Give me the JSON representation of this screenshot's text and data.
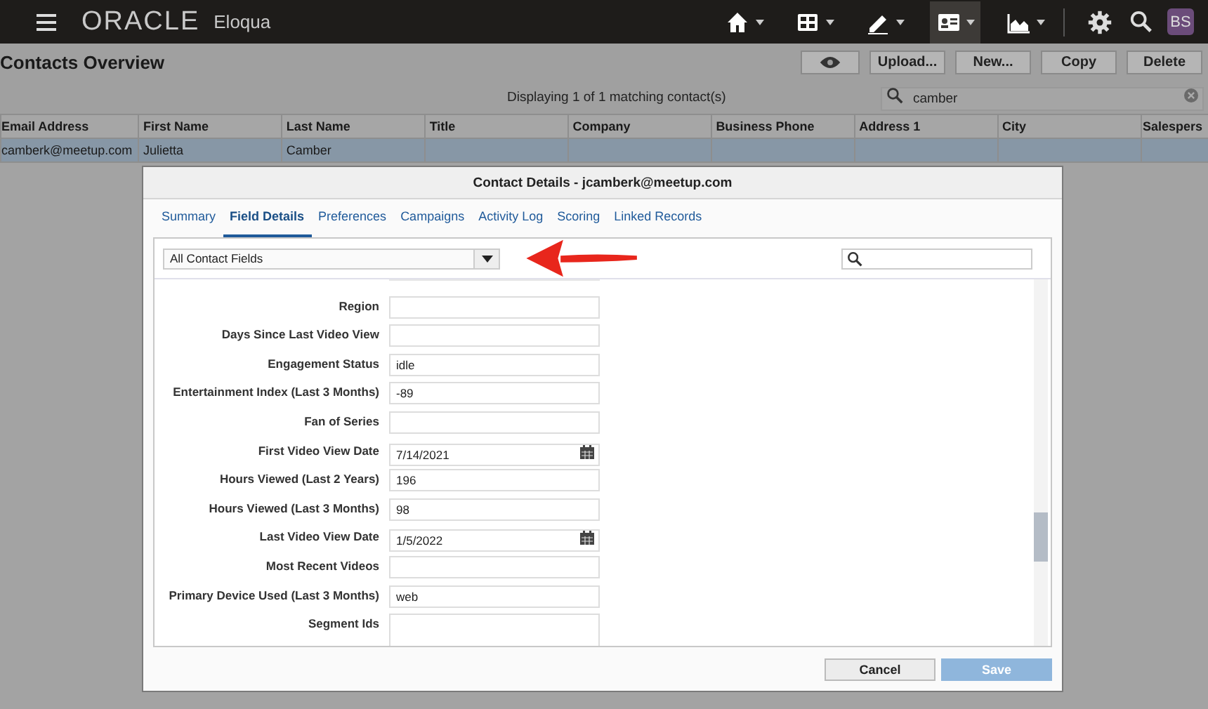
{
  "topbar": {
    "logo": "ORACLE",
    "product": "Eloqua",
    "nav": [
      {
        "kind": "home",
        "selected": false
      },
      {
        "kind": "dashboard",
        "selected": false
      },
      {
        "kind": "edit",
        "selected": false
      },
      {
        "kind": "contacts",
        "selected": true
      },
      {
        "kind": "chart",
        "selected": false
      }
    ],
    "avatar": "BS"
  },
  "page": {
    "title": "Contacts Overview",
    "buttons": [
      "Upload...",
      "New...",
      "Copy",
      "Delete"
    ],
    "status": "Displaying 1 of 1 matching contact(s)",
    "search": {
      "value": "camber"
    }
  },
  "table": {
    "columns": [
      "Email Address",
      "First Name",
      "Last Name",
      "Title",
      "Company",
      "Business Phone",
      "Address 1",
      "City",
      "Salespers"
    ],
    "rows": [
      {
        "cells": [
          "camberk@meetup.com",
          "Julietta",
          "Camber",
          "",
          "",
          "",
          "",
          "",
          ""
        ],
        "selected": true
      }
    ]
  },
  "dialog": {
    "title": "Contact Details - jcamberk@meetup.com",
    "tabs": [
      {
        "label": "Summary",
        "selected": false
      },
      {
        "label": "Field Details",
        "selected": true
      },
      {
        "label": "Preferences",
        "selected": false
      },
      {
        "label": "Campaigns",
        "selected": false
      },
      {
        "label": "Activity Log",
        "selected": false
      },
      {
        "label": "Scoring",
        "selected": false
      },
      {
        "label": "Linked Records",
        "selected": false
      }
    ],
    "filter": "All Contact Fields",
    "fields": [
      {
        "label": "Region",
        "kind": "text"
      },
      {
        "label": "Days Since Last Video View",
        "kind": "text"
      },
      {
        "label": "Engagement Status",
        "value": "idle",
        "kind": "text"
      },
      {
        "label": "Entertainment Index (Last 3 Months)",
        "value": "-89",
        "kind": "text"
      },
      {
        "label": "Fan of Series",
        "kind": "text"
      },
      {
        "label": "First Video View Date",
        "value": "7/14/2021",
        "kind": "date"
      },
      {
        "label": "Hours Viewed (Last 2 Years)",
        "value": "196",
        "kind": "text"
      },
      {
        "label": "Hours Viewed (Last 3 Months)",
        "value": "98",
        "kind": "text"
      },
      {
        "label": "Last Video View Date",
        "value": "1/5/2022",
        "kind": "date"
      },
      {
        "label": "Most Recent Videos",
        "kind": "text"
      },
      {
        "label": "Primary Device Used (Last 3 Months)",
        "value": "web",
        "kind": "text"
      },
      {
        "label": "Segment Ids",
        "kind": "textarea"
      }
    ],
    "buttons": [
      {
        "label": "Cancel",
        "disabled": false
      },
      {
        "label": "Save",
        "disabled": true
      }
    ]
  }
}
